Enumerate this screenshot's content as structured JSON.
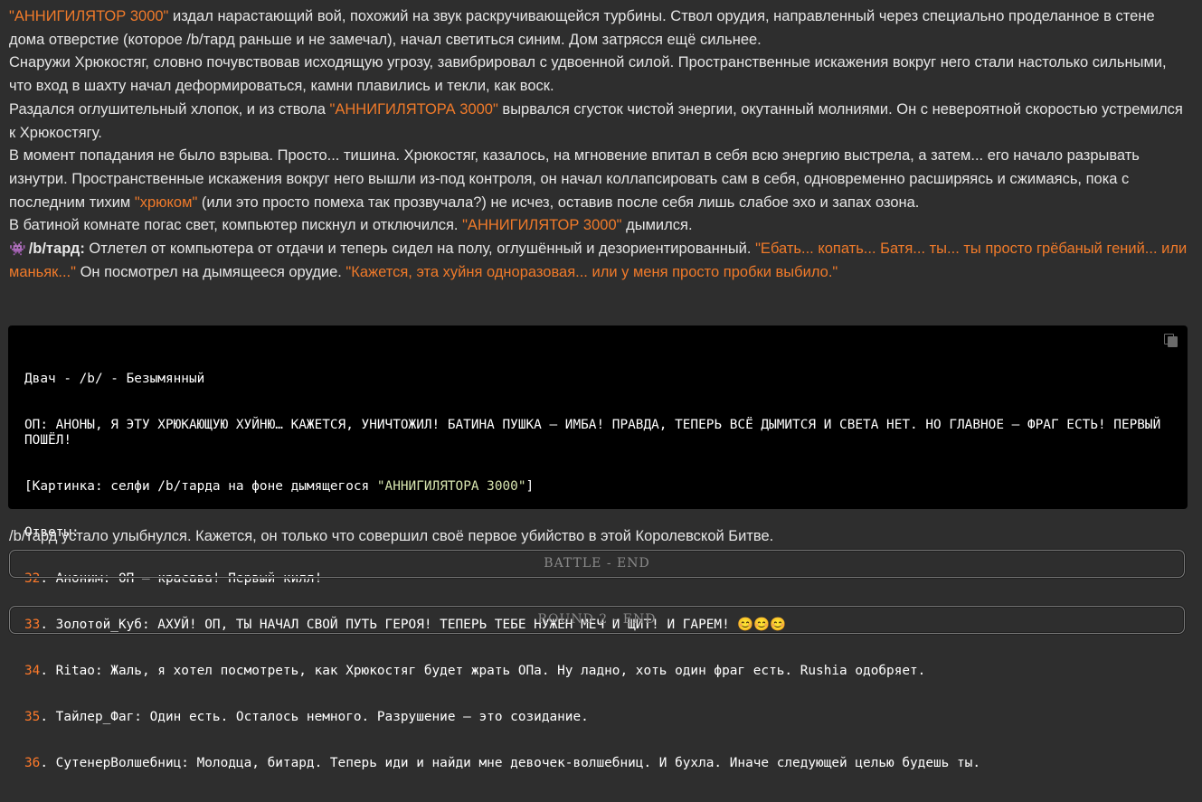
{
  "story": {
    "p1": {
      "a": "\"АННИГИЛЯТОР 3000\"",
      "b": " издал нарастающий вой, похожий на звук раскручивающейся турбины. Ствол орудия, направленный через специально проделанное в стене дома отверстие (которое /b/тард раньше и не замечал), начал светиться синим. Дом затрясся ещё сильнее."
    },
    "p2": "Снаружи Хрюкостяг, словно почувствовав исходящую угрозу, завибрировал с удвоенной силой. Пространственные искажения вокруг него стали настолько сильными, что вход в шахту начал деформироваться, камни плавились и текли, как воск.",
    "p3": {
      "a": "Раздался оглушительный хлопок, и из ствола ",
      "b": "\"АННИГИЛЯТОРА 3000\"",
      "c": " вырвался сгусток чистой энергии, окутанный молниями. Он с невероятной скоростью устремился к Хрюкостягу."
    },
    "p4": {
      "a": "В момент попадания не было взрыва. Просто... тишина. Хрюкостяг, казалось, на мгновение впитал в себя всю энергию выстрела, а затем... его начало разрывать изнутри. Пространственные искажения вокруг него вышли из-под контроля, он начал коллапсировать сам в себя, одновременно расширяясь и сжимаясь, пока с последним тихим ",
      "b": "\"хрюком\"",
      "c": " (или это просто помеха так прозвучала?) не исчез, оставив после себя лишь слабое эхо и запах озона."
    },
    "p5": {
      "a": "В батиной комнате погас свет, компьютер пискнул и отключился. ",
      "b": "\"АННИГИЛЯТОР 3000\"",
      "c": " дымился."
    },
    "p6": {
      "icon": "👾",
      "speaker": "/b/тард:",
      "a": " Отлетел от компьютера от отдачи и теперь сидел на полу, оглушённый и дезориентированный. ",
      "b": "\"Ебать... копать... Батя... ты... ты просто грёбаный гений... или маньяк...\"",
      "c": " Он посмотрел на дымящееся орудие. ",
      "d": "\"Кажется, эта хуйня одноразовая... или у меня просто пробки выбило.\""
    }
  },
  "thread": {
    "header": "Двач - /b/ - Безымянный",
    "op": "ОП: АНОНЫ, Я ЭТУ ХРЮКАЮЩУЮ ХУЙНЮ… КАЖЕТСЯ, УНИЧТОЖИЛ! БАТИНА ПУШКА – ИМБА! ПРАВДА, ТЕПЕРЬ ВСЁ ДЫМИТСЯ И СВЕТА НЕТ. НО ГЛАВНОЕ – ФРАГ ЕСТЬ! ПЕРВЫЙ ПОШЁЛ!",
    "pic_a": "[Картинка: селфи /b/тарда на фоне дымящегося ",
    "pic_b": "\"АННИГИЛЯТОРА 3000\"",
    "pic_c": "]",
    "replies_label": "Ответы:",
    "replies": [
      {
        "num": "32",
        "text": ". Аноним: ОП – красава! Первый килл!"
      },
      {
        "num": "33",
        "text": ". Золотой_Куб: АХУЙ! ОП, ТЫ НАЧАЛ СВОЙ ПУТЬ ГЕРОЯ! ТЕПЕРЬ ТЕБЕ НУЖЕН МЕЧ И ЩИТ! И ГАРЕМ! 😊😊😊"
      },
      {
        "num": "34",
        "text": ". Ritao: Жаль, я хотел посмотреть, как Хрюкостяг будет жрать ОПа. Ну ладно, хоть один фраг есть. Rushia одобряет."
      },
      {
        "num": "35",
        "text": ". Тайлер_Фаг: Один есть. Осталось немного. Разрушение – это созидание."
      },
      {
        "num": "36",
        "text": ". СутенерВолшебниц: Молодца, битард. Теперь иди и найди мне девочек-волшебниц. И бухла. Иначе следующей целью будешь ты."
      }
    ]
  },
  "tail_text": "/b/тард устало улыбнулся. Кажется, он только что совершил своё первое убийство в этой Королевской Битве.",
  "dividers": {
    "battle": "BATTLE - END",
    "round": "ROUND 2 - END"
  },
  "colors": {
    "highlight": "#f07a2a",
    "background": "#2e2e2e",
    "code_background": "#000000"
  }
}
